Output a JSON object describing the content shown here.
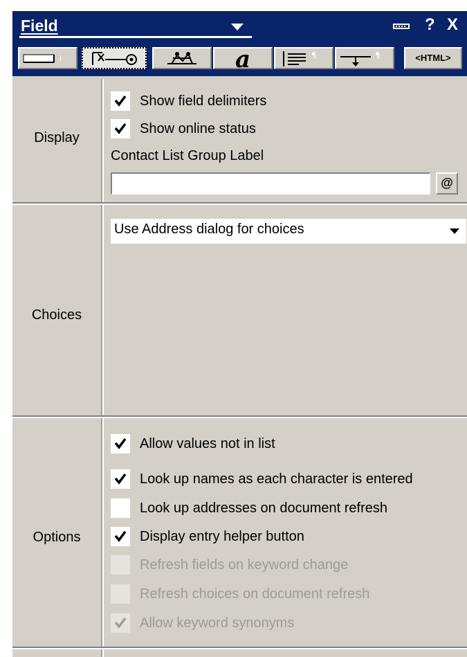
{
  "window": {
    "title": "Field",
    "buttons": {
      "help": "?",
      "close": "X"
    }
  },
  "tabs": [
    {
      "icon": "field-info-icon"
    },
    {
      "icon": "control-icon",
      "active": true
    },
    {
      "icon": "advanced-icon"
    },
    {
      "icon": "font-icon",
      "label": "a"
    },
    {
      "icon": "paragraph-alignment-icon"
    },
    {
      "icon": "paragraph-margins-icon"
    },
    {
      "icon": "html-tags-icon",
      "label": "<HTML>"
    }
  ],
  "display": {
    "label": "Display",
    "show_field_delimiters": {
      "label": "Show field delimiters",
      "checked": true
    },
    "show_online_status": {
      "label": "Show online status",
      "checked": true
    },
    "group_label_caption": "Contact List Group Label",
    "group_label_value": "",
    "formula_button": "@"
  },
  "choices": {
    "label": "Choices",
    "selected": "Use Address dialog for choices"
  },
  "options": {
    "label": "Options",
    "items": [
      {
        "label": "Allow values not in list",
        "checked": true,
        "enabled": true
      },
      {
        "label": "Look up names as each character is entered",
        "checked": true,
        "enabled": true
      },
      {
        "label": "Look up addresses on document refresh",
        "checked": false,
        "enabled": true
      },
      {
        "label": "Display entry helper button",
        "checked": true,
        "enabled": true
      },
      {
        "label": "Refresh fields on keyword change",
        "checked": false,
        "enabled": false
      },
      {
        "label": "Refresh choices on document refresh",
        "checked": false,
        "enabled": false
      },
      {
        "label": "Allow keyword synonyms",
        "checked": true,
        "enabled": false
      }
    ]
  },
  "colors": {
    "title_bar": "#0a246a",
    "panel": "#d4d0c8",
    "disabled_text": "#9c9a95"
  }
}
